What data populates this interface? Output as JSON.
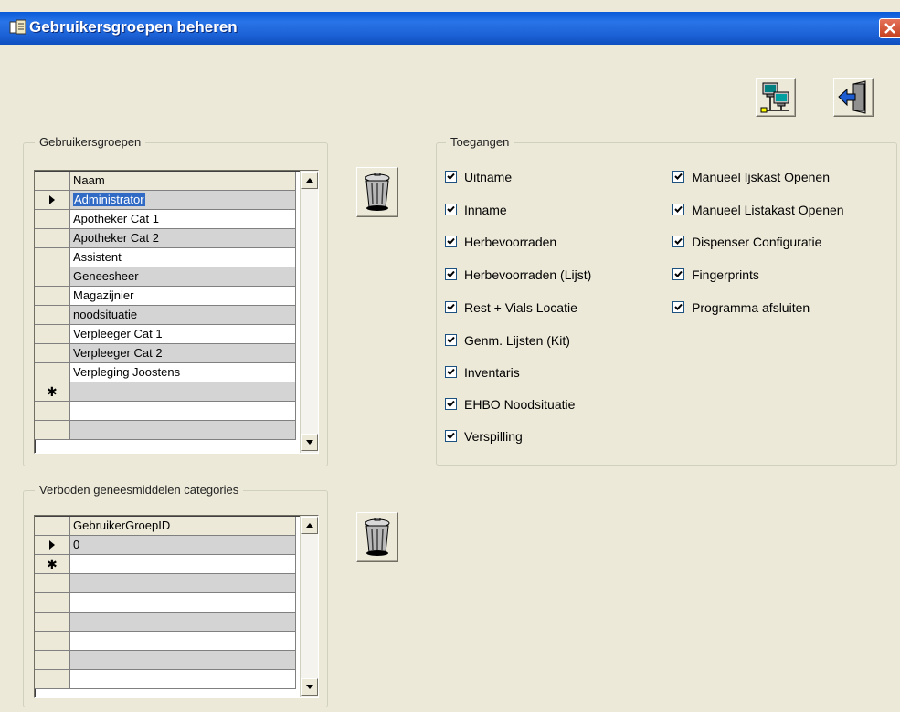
{
  "window": {
    "title": "Gebruikersgroepen beheren"
  },
  "toolbar": {
    "network_icon": "network-computers-icon",
    "exit_icon": "exit-door-icon"
  },
  "groups_panel": {
    "legend": "Gebruikersgroepen",
    "column": "Naam",
    "rows": [
      "Administrator",
      "Apotheker Cat 1",
      "Apotheker Cat 2",
      "Assistent",
      "Geneesheer",
      "Magazijnier",
      "noodsituatie",
      "Verpleeger Cat  1",
      "Verpleeger Cat 2",
      "Verpleging Joostens"
    ],
    "selected_index": 0,
    "new_row_marker": "✱"
  },
  "categories_panel": {
    "legend": "Verboden geneesmiddelen categories",
    "column": "GebruikerGroepID",
    "rows": [
      "0"
    ],
    "new_row_marker": "✱"
  },
  "access_panel": {
    "legend": "Toegangen",
    "left": [
      {
        "label": "Uitname",
        "checked": true
      },
      {
        "label": "Inname",
        "checked": true
      },
      {
        "label": "Herbevoorraden",
        "checked": true
      },
      {
        "label": "Herbevoorraden (Lijst)",
        "checked": true
      },
      {
        "label": "Rest + Vials Locatie",
        "checked": true
      },
      {
        "label": "Genm. Lijsten (Kit)",
        "checked": true
      },
      {
        "label": "Inventaris",
        "checked": true
      },
      {
        "label": "EHBO Noodsituatie",
        "checked": true
      },
      {
        "label": "Verspilling",
        "checked": true
      }
    ],
    "right": [
      {
        "label": "Manueel Ijskast Openen",
        "checked": true
      },
      {
        "label": "Manueel Listakast Openen",
        "checked": true
      },
      {
        "label": "Dispenser Configuratie",
        "checked": true
      },
      {
        "label": "Fingerprints",
        "checked": true
      },
      {
        "label": "Programma afsluiten",
        "checked": true
      }
    ]
  },
  "colors": {
    "title_bar": "#1c62d6",
    "window_bg": "#ece9d8",
    "grid_alt_row": "#d4d4d4",
    "selection": "#316ac5"
  }
}
